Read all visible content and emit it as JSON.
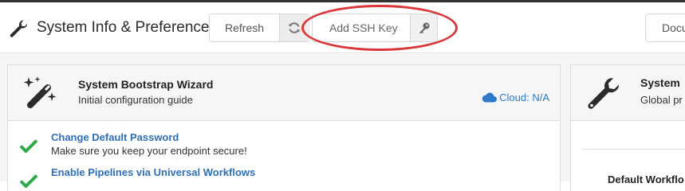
{
  "header": {
    "title": "System Info & Preferences",
    "refresh_label": "Refresh",
    "add_ssh_key_label": "Add SSH Key",
    "docs_label": "Docu"
  },
  "bootstrap_card": {
    "title": "System Bootstrap Wizard",
    "subtitle": "Initial configuration guide",
    "cloud_status": "Cloud: N/A",
    "tasks": [
      {
        "title": "Change Default Password",
        "description": "Make sure you keep your endpoint secure!"
      },
      {
        "title": "Enable Pipelines via Universal Workflows",
        "description": ""
      }
    ]
  },
  "system_card": {
    "title": "System",
    "subtitle": "Global pr",
    "field_label": "Default Workflo"
  },
  "colors": {
    "accent_blue": "#2f6fb4",
    "success_green": "#2eaa4a",
    "highlight_red": "#d9373a"
  }
}
